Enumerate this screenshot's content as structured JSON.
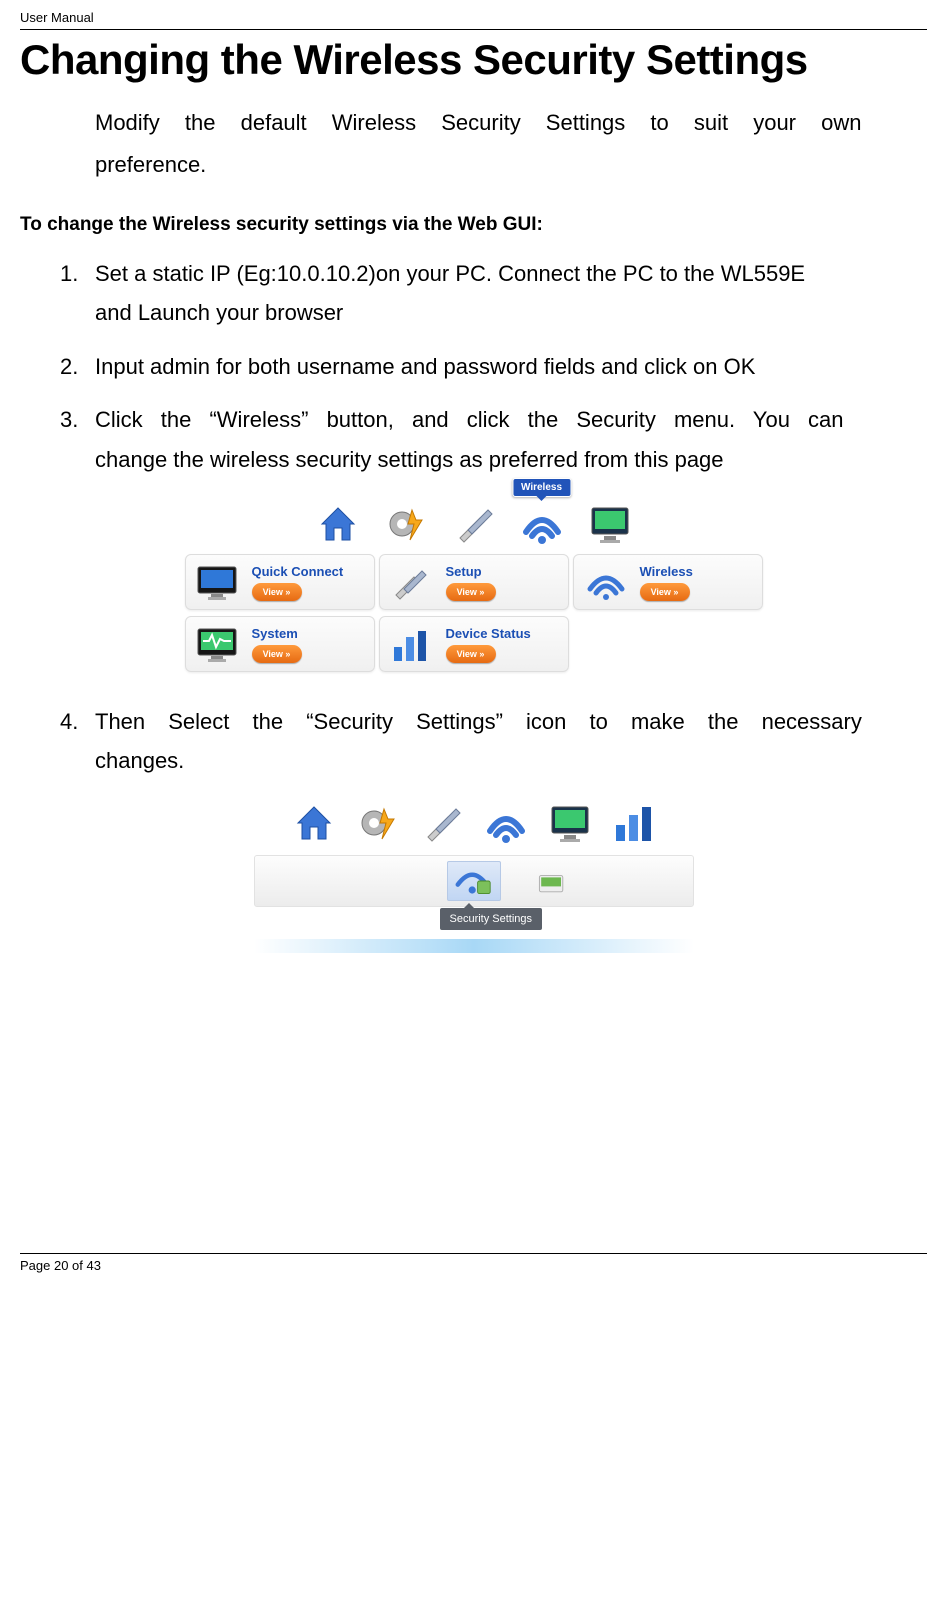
{
  "doc_header": "User Manual",
  "title": "Changing the Wireless Security Settings",
  "intro_l1": "Modify the default Wireless Security Settings to suit your own",
  "intro_l2": "preference.",
  "subhead": "To change the Wireless security settings via the Web GUI:",
  "steps": {
    "s1": {
      "num": "1.",
      "l1": "Set a static IP (Eg:10.0.10.2)on your PC. Connect the PC to the WL559E",
      "l2": "and Launch your browser"
    },
    "s2": {
      "num": "2.",
      "l1": "Input admin for both username and password fields and click on OK"
    },
    "s3": {
      "num": "3.",
      "l1": "Click the “Wireless” button, and click the Security menu. You can",
      "l2": "change the wireless security settings as preferred from this page"
    },
    "s4": {
      "num": "4.",
      "l1": "Then Select the “Security Settings” icon to make the necessary",
      "l2": "changes."
    }
  },
  "tiles": {
    "quick_connect": "Quick Connect",
    "setup": "Setup",
    "wireless": "Wireless",
    "system": "System",
    "device_status": "Device Status",
    "view_btn": "View »",
    "wireless_badge": "Wireless"
  },
  "tooltip": {
    "security": "Security Settings"
  },
  "footer": {
    "page": "Page 20 of 43"
  }
}
